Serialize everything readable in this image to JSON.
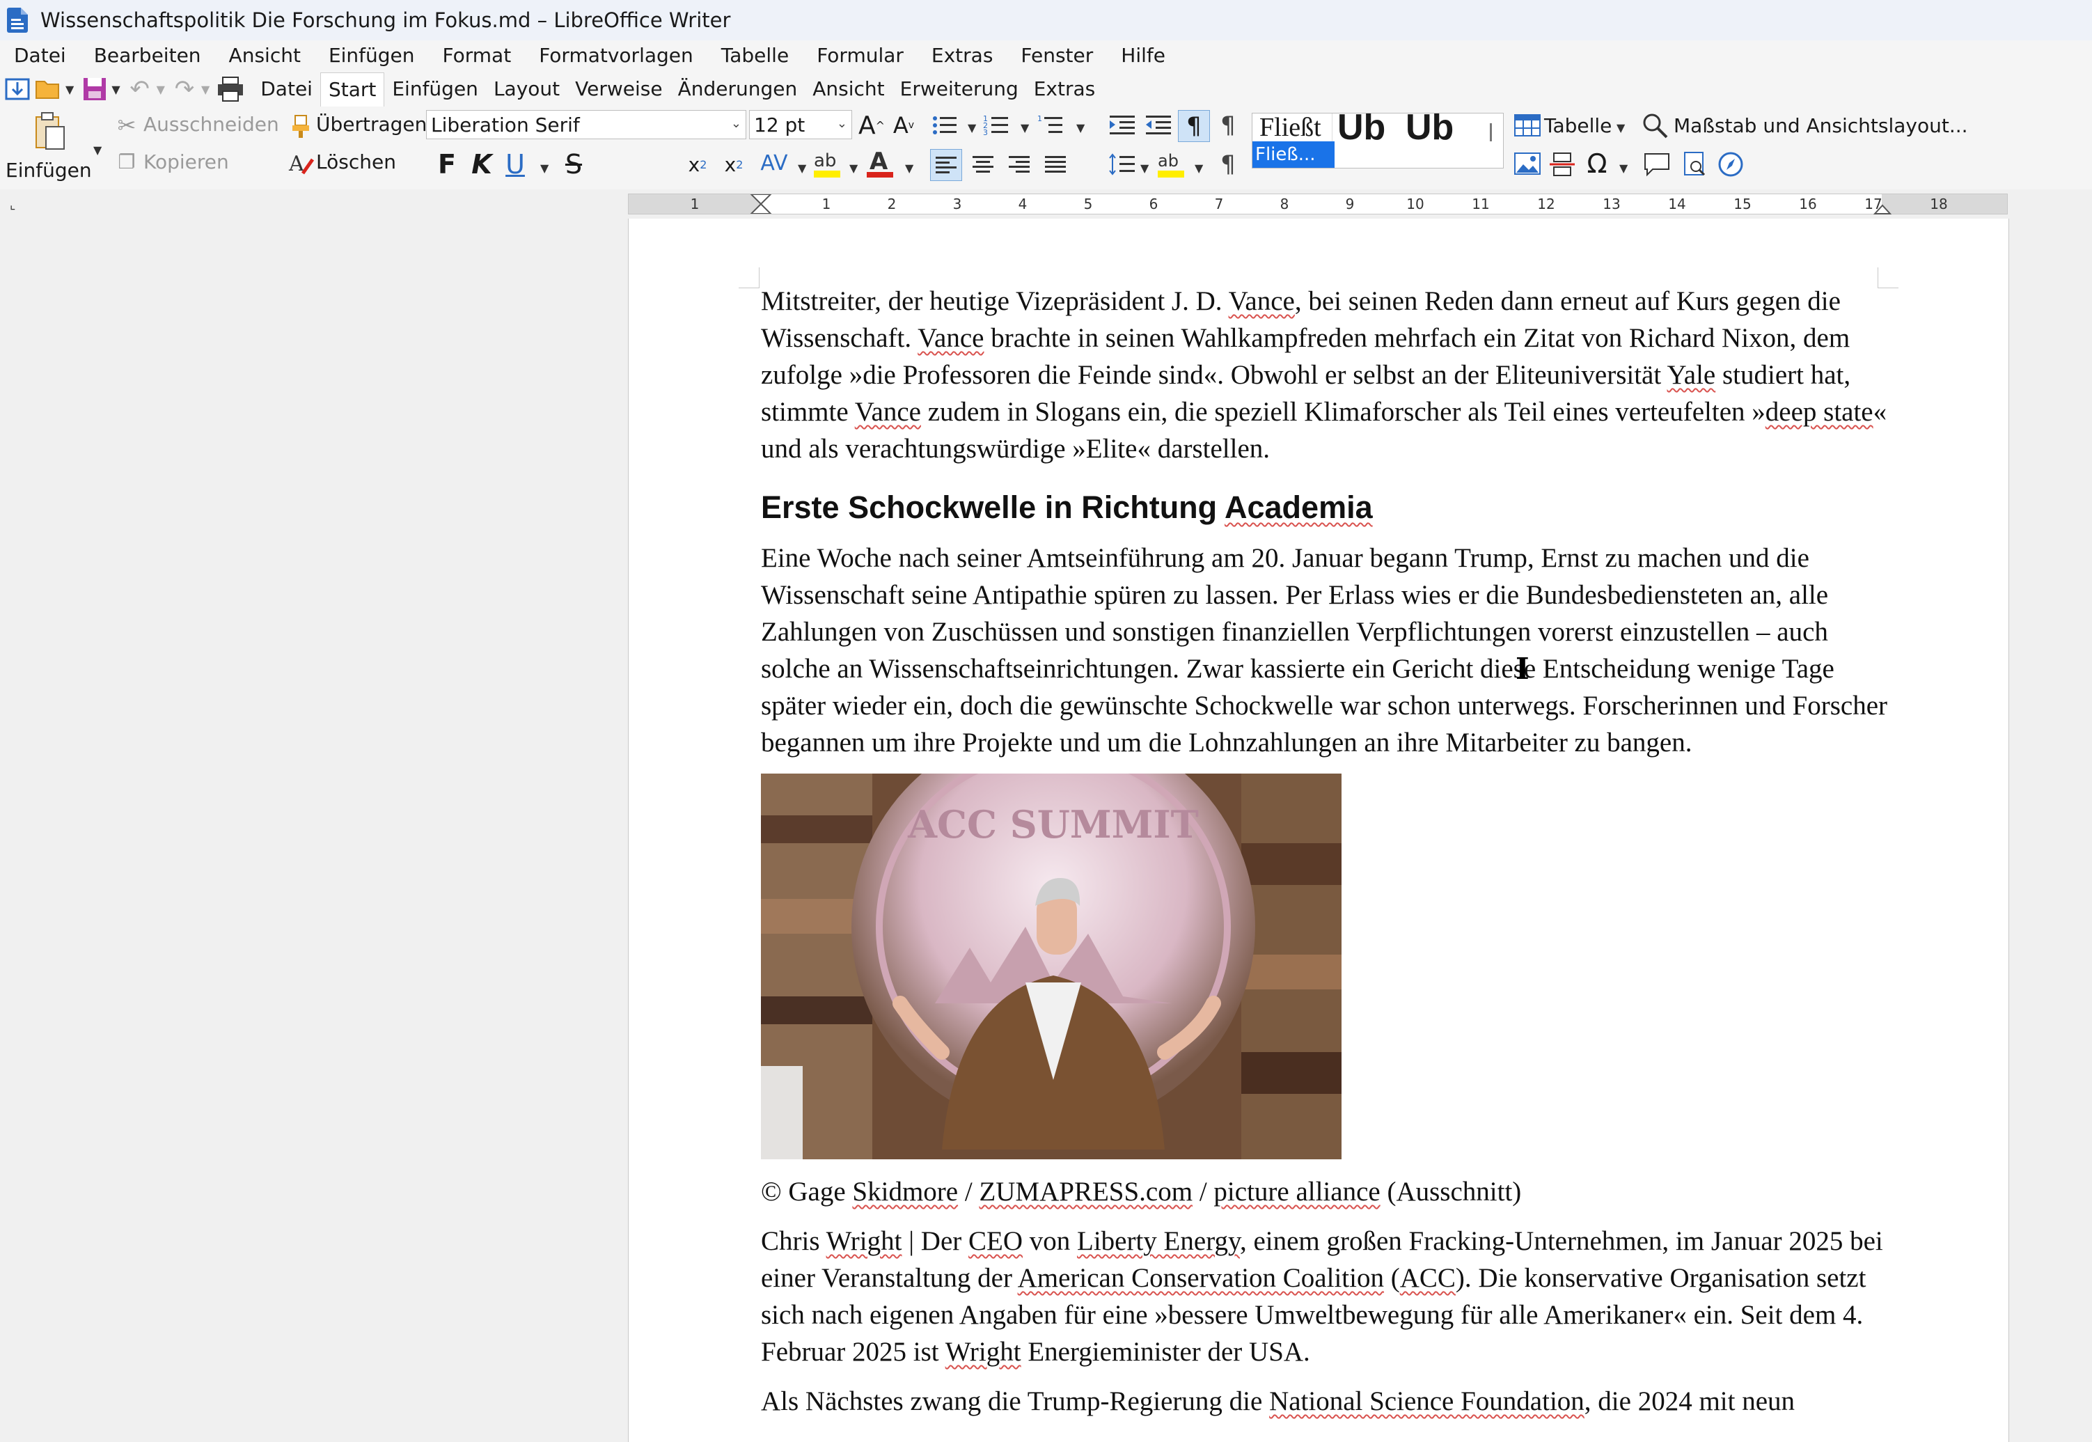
{
  "window": {
    "title": "Wissenschaftspolitik Die Forschung im Fokus.md – LibreOffice Writer"
  },
  "menu": [
    "Datei",
    "Bearbeiten",
    "Ansicht",
    "Einfügen",
    "Format",
    "Formatvorlagen",
    "Tabelle",
    "Formular",
    "Extras",
    "Fenster",
    "Hilfe"
  ],
  "tabs": [
    "Datei",
    "Start",
    "Einfügen",
    "Layout",
    "Verweise",
    "Änderungen",
    "Ansicht",
    "Erweiterung",
    "Extras"
  ],
  "active_tab": "Start",
  "toolbar": {
    "paste": "Einfügen",
    "cut": "Ausschneiden",
    "copy": "Kopieren",
    "clone": "Übertragen",
    "clear": "Löschen",
    "font_name": "Liberation Serif",
    "font_size": "12 pt",
    "bold": "F",
    "italic": "K",
    "underline": "U",
    "strike": "S",
    "style_preview_1": "Fließt",
    "style_preview_2": "Üb",
    "style_preview_3": "Üb",
    "style_selected": "Fließ...",
    "table": "Tabelle",
    "zoom": "Maßstab und Ansichtslayout..."
  },
  "ruler": {
    "numbers": [
      "1",
      "1",
      "2",
      "3",
      "4",
      "5",
      "6",
      "7",
      "8",
      "9",
      "10",
      "11",
      "12",
      "13",
      "14",
      "15",
      "16",
      "17",
      "18"
    ]
  },
  "document": {
    "p1": [
      {
        "t": "Mitstreiter, der heutige Vizepräsident J. D. "
      },
      {
        "t": "Vance",
        "s": true
      },
      {
        "t": ", bei seinen Reden dann erneut auf Kurs gegen die Wissenschaft. "
      },
      {
        "t": "Vance",
        "s": true
      },
      {
        "t": " brachte in seinen Wahlkampfreden mehrfach ein Zitat von Richard Nixon, dem zufolge »die Professoren die Feinde sind«. Obwohl er selbst an der Eliteuniversität "
      },
      {
        "t": "Yale",
        "s": true
      },
      {
        "t": " studiert hat, stimmte "
      },
      {
        "t": "Vance",
        "s": true
      },
      {
        "t": " zudem in Slogans ein, die speziell Klimaforscher als Teil eines verteufelten »"
      },
      {
        "t": "deep state",
        "s": true
      },
      {
        "t": "« und als verachtungswürdige »Elite« darstellen."
      }
    ],
    "heading": [
      {
        "t": "Erste Schockwelle in Richtung "
      },
      {
        "t": "Academia",
        "s": true
      }
    ],
    "p2": [
      {
        "t": "Eine Woche nach seiner Amtseinführung am 20. Januar begann Trump, Ernst zu machen und die Wissenschaft seine Antipathie spüren zu lassen. Per Erlass wies er die Bundesbediensteten an, alle Zahlungen von Zuschüssen und sonstigen finanziellen Verpflichtungen vorerst einzustellen – auch solche an Wissenschaftseinrichtungen. Zwar kassierte ein Gericht diese Entscheidung wenige Tage später wieder ein, doch die gewünschte Schockwelle war schon unterwegs. Forscherinnen und Forscher begannen um ihre Projekte und um die Lohnzahlungen an ihre Mitarbeiter zu bangen."
      }
    ],
    "image_sign": "ACC SUMMIT",
    "caption": [
      {
        "t": "© Gage "
      },
      {
        "t": "Skidmore",
        "s": true
      },
      {
        "t": " / "
      },
      {
        "t": "ZUMAPRESS.com",
        "s": true
      },
      {
        "t": " / "
      },
      {
        "t": "picture alliance",
        "s": true
      },
      {
        "t": " (Ausschnitt)"
      }
    ],
    "p3": [
      {
        "t": "Chris "
      },
      {
        "t": "Wright",
        "s": true
      },
      {
        "t": " | Der "
      },
      {
        "t": "CEO",
        "s": true
      },
      {
        "t": " von "
      },
      {
        "t": "Liberty Energy",
        "s": true
      },
      {
        "t": ", einem großen Fracking-Unternehmen, im Januar 2025 bei einer Veranstaltung der "
      },
      {
        "t": "American Conservation Coalition",
        "s": true
      },
      {
        "t": " ("
      },
      {
        "t": "ACC",
        "s": true
      },
      {
        "t": "). Die konservative Organisation setzt sich nach eigenen Angaben für eine »bessere Umweltbewegung für alle Amerikaner« ein. Seit dem 4. Februar 2025 ist "
      },
      {
        "t": "Wright",
        "s": true
      },
      {
        "t": " Energieminister der USA."
      }
    ],
    "p4": [
      {
        "t": "Als Nächstes zwang die Trump-Regierung die "
      },
      {
        "t": "National Science Foundation",
        "s": true
      },
      {
        "t": ", die 2024 mit neun"
      }
    ]
  }
}
